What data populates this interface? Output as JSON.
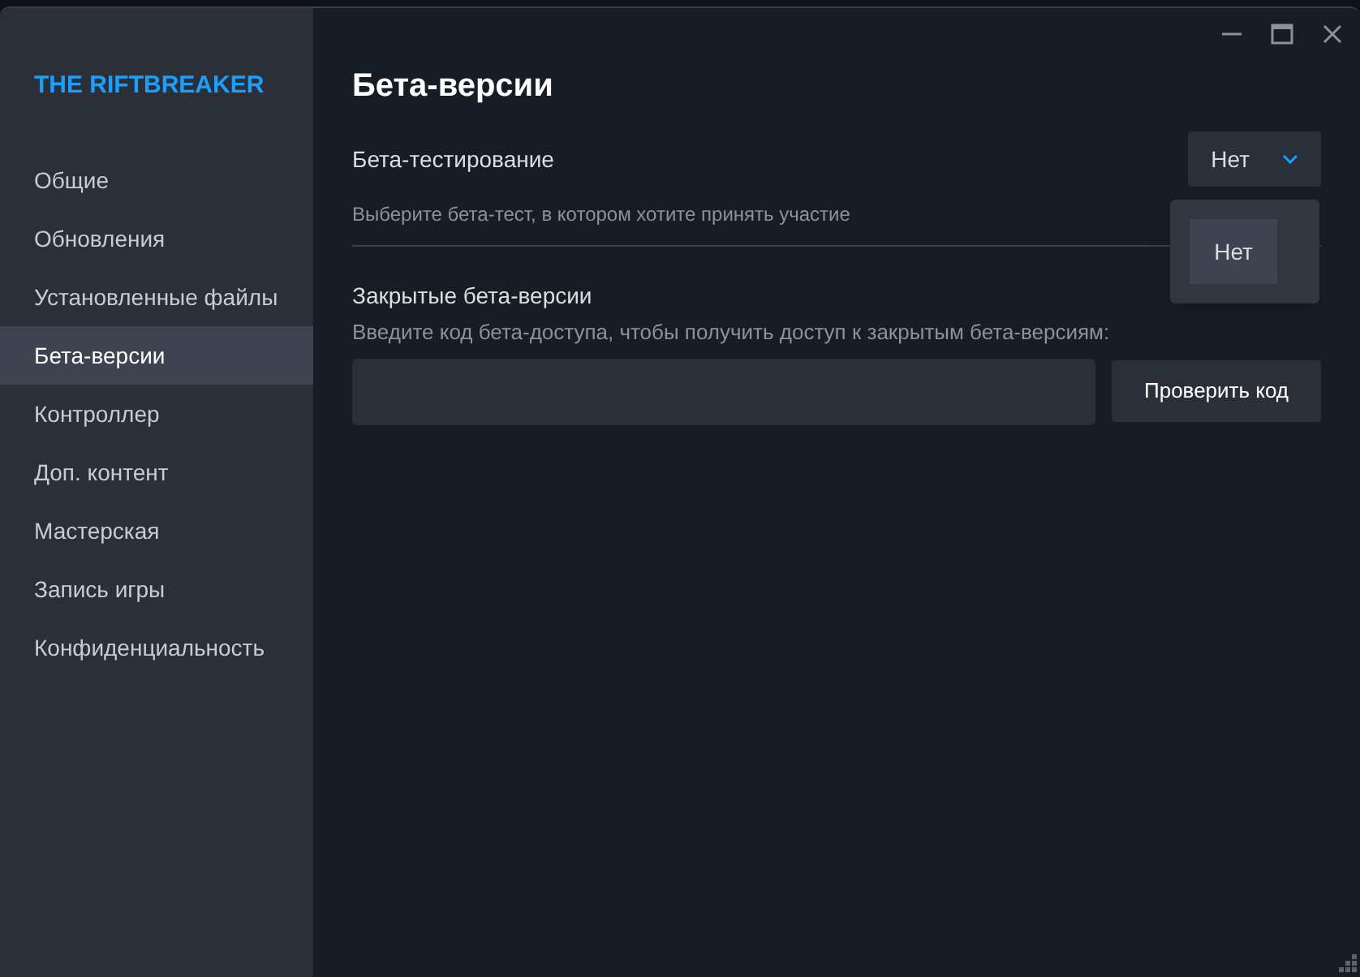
{
  "sidebar": {
    "title": "THE RIFTBREAKER",
    "items": [
      {
        "label": "Общие",
        "selected": false
      },
      {
        "label": "Обновления",
        "selected": false
      },
      {
        "label": "Установленные файлы",
        "selected": false
      },
      {
        "label": "Бета-версии",
        "selected": true
      },
      {
        "label": "Контроллер",
        "selected": false
      },
      {
        "label": "Доп. контент",
        "selected": false
      },
      {
        "label": "Мастерская",
        "selected": false
      },
      {
        "label": "Запись игры",
        "selected": false
      },
      {
        "label": "Конфиденциальность",
        "selected": false
      }
    ]
  },
  "main": {
    "title": "Бета-версии",
    "beta": {
      "label": "Бета-тестирование",
      "hint": "Выберите бета-тест, в котором хотите принять участие",
      "value": "Нет",
      "expanded": true,
      "options": [
        {
          "label": "Нет",
          "selected": true
        }
      ]
    },
    "private": {
      "label": "Закрытые бета-версии",
      "hint": "Введите код бета-доступа, чтобы получить доступ к закрытым бета-версиям:",
      "button": "Проверить код"
    }
  }
}
